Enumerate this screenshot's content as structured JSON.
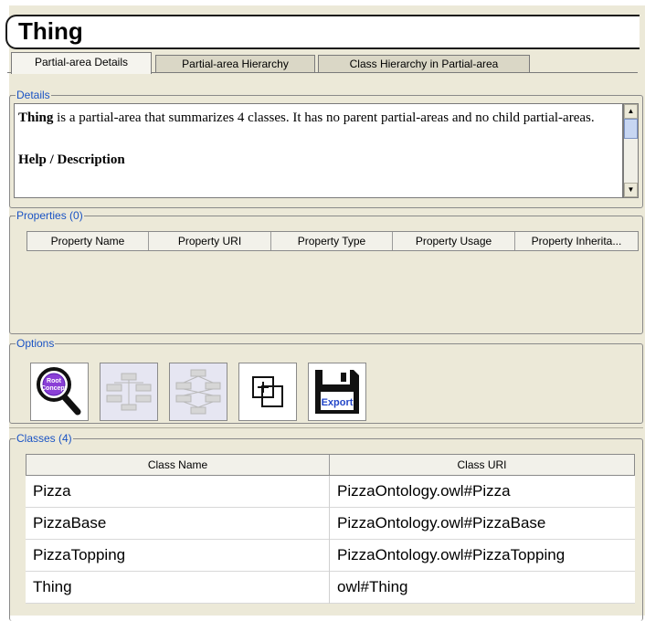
{
  "title": "Thing",
  "tabs": [
    {
      "label": "Partial-area Details",
      "active": true
    },
    {
      "label": "Partial-area Hierarchy",
      "active": false
    },
    {
      "label": "Class Hierarchy in Partial-area",
      "active": false
    }
  ],
  "details": {
    "legend": "Details",
    "subject": "Thing",
    "summary": " is a partial-area that summarizes 4 classes. It has no parent partial-areas and no child partial-areas.",
    "help_heading": "Help / Description"
  },
  "properties": {
    "legend": "Properties (0)",
    "columns": [
      "Property Name",
      "Property URI",
      "Property Type",
      "Property Usage",
      "Property Inherita..."
    ]
  },
  "options": {
    "legend": "Options",
    "icons": [
      "root-concept-search-icon",
      "hierarchy-icon",
      "expanded-hierarchy-icon",
      "add-frame-icon",
      "export-save-icon"
    ],
    "root_label_1": "Root",
    "root_label_2": "Concept",
    "export_label": "Export"
  },
  "classes": {
    "legend": "Classes (4)",
    "columns": [
      "Class Name",
      "Class URI"
    ],
    "rows": [
      {
        "name": "Pizza",
        "uri": "PizzaOntology.owl#Pizza"
      },
      {
        "name": "PizzaBase",
        "uri": "PizzaOntology.owl#PizzaBase"
      },
      {
        "name": "PizzaTopping",
        "uri": "PizzaOntology.owl#PizzaTopping"
      },
      {
        "name": "Thing",
        "uri": "owl#Thing"
      }
    ]
  },
  "colors": {
    "legend": "#1a53c4",
    "panel": "#ece9d8",
    "export_icon": "#2346c8"
  }
}
